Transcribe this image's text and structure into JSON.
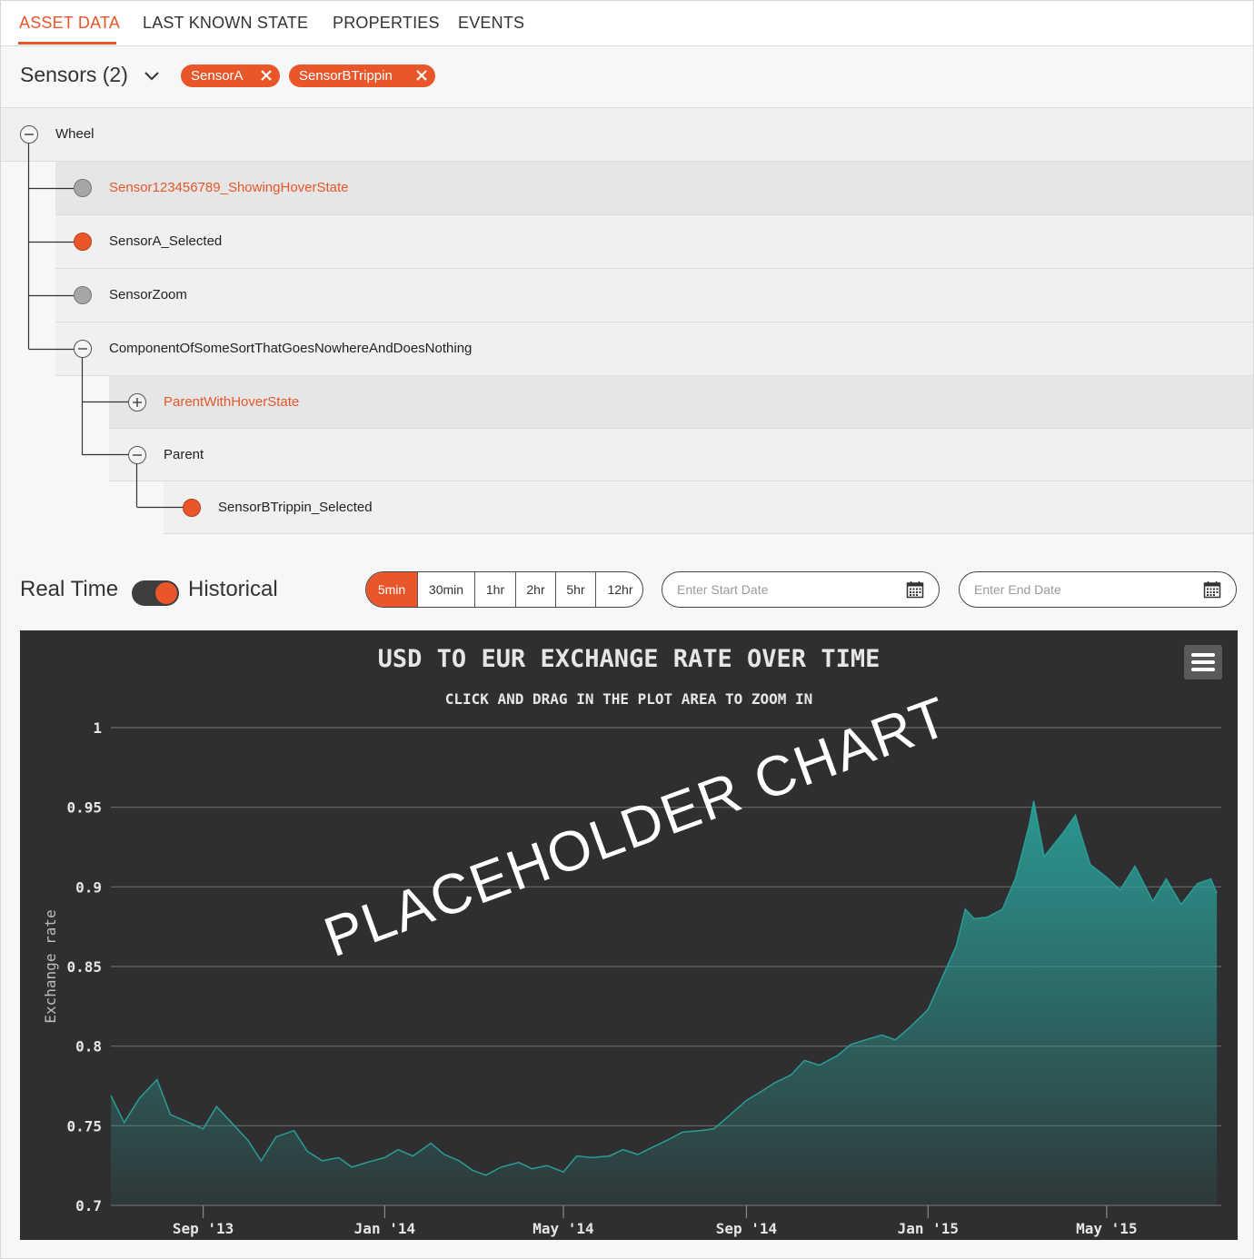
{
  "tabs": [
    {
      "label": "ASSET DATA",
      "active": true
    },
    {
      "label": "LAST KNOWN STATE",
      "active": false
    },
    {
      "label": "PROPERTIES",
      "active": false
    },
    {
      "label": "EVENTS",
      "active": false
    }
  ],
  "sensors": {
    "title": "Sensors (2)",
    "chips": [
      {
        "label": "SensorA"
      },
      {
        "label": "SensorBTrippin"
      }
    ]
  },
  "tree": [
    {
      "label": "Wheel",
      "type": "collapse",
      "level": 0,
      "state": "normal"
    },
    {
      "label": "Sensor123456789_ShowingHoverState",
      "type": "sensor",
      "level": 1,
      "state": "hover"
    },
    {
      "label": "SensorA_Selected",
      "type": "sensor",
      "level": 1,
      "state": "selected"
    },
    {
      "label": "SensorZoom",
      "type": "sensor",
      "level": 1,
      "state": "normal"
    },
    {
      "label": "ComponentOfSomeSortThatGoesNowhereAndDoesNothing",
      "type": "collapse",
      "level": 1,
      "state": "normal"
    },
    {
      "label": "ParentWithHoverState",
      "type": "expand",
      "level": 2,
      "state": "hover"
    },
    {
      "label": "Parent",
      "type": "collapse",
      "level": 2,
      "state": "normal"
    },
    {
      "label": "SensorBTrippin_Selected",
      "type": "sensor",
      "level": 3,
      "state": "selected"
    }
  ],
  "controls": {
    "realtime_label": "Real Time",
    "historical_label": "Historical",
    "mode": "historical",
    "intervals": [
      "5min",
      "30min",
      "1hr",
      "2hr",
      "5hr",
      "12hr"
    ],
    "active_interval": "5min",
    "start_date_placeholder": "Enter Start Date",
    "end_date_placeholder": "Enter End Date"
  },
  "colors": {
    "accent": "#e8562a",
    "chart_bg": "#2f2f31",
    "series": "#2a9d96"
  },
  "chart_data": {
    "type": "area",
    "title": "USD TO EUR EXCHANGE RATE OVER TIME",
    "subtitle": "CLICK AND DRAG IN THE PLOT AREA TO ZOOM IN",
    "ylabel": "Exchange rate",
    "xlabel": "",
    "watermark": "PLACEHOLDER CHART",
    "ylim": [
      0.7,
      1.0
    ],
    "yticks": [
      "0.7",
      "0.75",
      "0.8",
      "0.85",
      "0.9",
      "0.95",
      "1"
    ],
    "xlim": [
      "2013-07-01",
      "2015-07-17"
    ],
    "xticks": [
      {
        "date": "2013-09-01",
        "label": "Sep '13"
      },
      {
        "date": "2014-01-01",
        "label": "Jan '14"
      },
      {
        "date": "2014-05-01",
        "label": "May '14"
      },
      {
        "date": "2014-09-01",
        "label": "Sep '14"
      },
      {
        "date": "2015-01-01",
        "label": "Jan '15"
      },
      {
        "date": "2015-05-01",
        "label": "May '15"
      }
    ],
    "grid": true,
    "series": [
      {
        "x": [
          "2013-07-01",
          "2013-07-10",
          "2013-07-20",
          "2013-08-01",
          "2013-08-10",
          "2013-08-20",
          "2013-09-01",
          "2013-09-10",
          "2013-09-20",
          "2013-10-01",
          "2013-10-10",
          "2013-10-20",
          "2013-11-01",
          "2013-11-10",
          "2013-11-20",
          "2013-12-01",
          "2013-12-10",
          "2013-12-20",
          "2014-01-01",
          "2014-01-10",
          "2014-01-20",
          "2014-02-01",
          "2014-02-10",
          "2014-02-20",
          "2014-03-01",
          "2014-03-10",
          "2014-03-20",
          "2014-04-01",
          "2014-04-10",
          "2014-04-20",
          "2014-05-01",
          "2014-05-10",
          "2014-05-20",
          "2014-06-01",
          "2014-06-10",
          "2014-06-20",
          "2014-07-01",
          "2014-07-10",
          "2014-07-20",
          "2014-08-01",
          "2014-08-10",
          "2014-08-20",
          "2014-09-01",
          "2014-09-10",
          "2014-09-20",
          "2014-10-01",
          "2014-10-10",
          "2014-10-20",
          "2014-11-01",
          "2014-11-10",
          "2014-11-20",
          "2014-12-01",
          "2014-12-10",
          "2014-12-20",
          "2015-01-01",
          "2015-01-10",
          "2015-01-20",
          "2015-01-26",
          "2015-02-01",
          "2015-02-10",
          "2015-02-20",
          "2015-03-01",
          "2015-03-10",
          "2015-03-13",
          "2015-03-20",
          "2015-04-01",
          "2015-04-10",
          "2015-04-13",
          "2015-04-20",
          "2015-05-01",
          "2015-05-10",
          "2015-05-20",
          "2015-06-01",
          "2015-06-10",
          "2015-06-20",
          "2015-07-01",
          "2015-07-10",
          "2015-07-14"
        ],
        "values": [
          0.769,
          0.752,
          0.767,
          0.779,
          0.757,
          0.753,
          0.748,
          0.762,
          0.752,
          0.741,
          0.728,
          0.743,
          0.747,
          0.734,
          0.728,
          0.73,
          0.724,
          0.727,
          0.73,
          0.735,
          0.731,
          0.739,
          0.732,
          0.728,
          0.722,
          0.719,
          0.724,
          0.727,
          0.723,
          0.725,
          0.721,
          0.731,
          0.73,
          0.731,
          0.735,
          0.732,
          0.737,
          0.741,
          0.746,
          0.747,
          0.748,
          0.756,
          0.766,
          0.771,
          0.777,
          0.782,
          0.791,
          0.788,
          0.794,
          0.801,
          0.804,
          0.807,
          0.804,
          0.812,
          0.823,
          0.842,
          0.863,
          0.886,
          0.88,
          0.881,
          0.886,
          0.906,
          0.939,
          0.954,
          0.919,
          0.933,
          0.945,
          0.935,
          0.914,
          0.906,
          0.898,
          0.913,
          0.891,
          0.905,
          0.889,
          0.902,
          0.905,
          0.896
        ]
      }
    ]
  }
}
